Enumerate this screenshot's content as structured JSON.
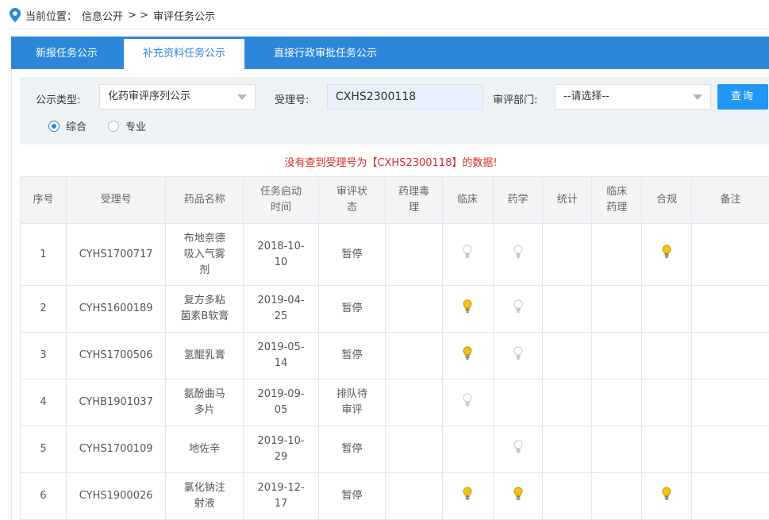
{
  "breadcrumb": {
    "prefix": "当前位置：",
    "path": "信息公开",
    "sep": "> >",
    "current": "审评任务公示"
  },
  "tabs": [
    {
      "label": "新报任务公示",
      "active": false
    },
    {
      "label": "补充资料任务公示",
      "active": true
    },
    {
      "label": "直接行政审批任务公示",
      "active": false
    }
  ],
  "filter": {
    "type_label": "公示类型:",
    "type_value": "化药审评序列公示",
    "accept_label": "受理号:",
    "accept_value": "CXHS2300118",
    "dept_label": "审评部门:",
    "dept_value": "--请选择--",
    "query_button": "查询",
    "radio_general": "综合",
    "radio_special": "专业",
    "selected_radio": "综合"
  },
  "message": "没有查到受理号为【CXHS2300118】的数据!",
  "colors": {
    "accent": "#2c87db",
    "bulb_on": "#f1c21b",
    "bulb_off": "#c9c9c9",
    "alert": "#d62a2a"
  },
  "table": {
    "headers": [
      "序号",
      "受理号",
      "药品名称",
      "任务启动时间",
      "审评状态",
      "药理毒理",
      "临床",
      "药学",
      "统计",
      "临床药理",
      "合规",
      "备注"
    ],
    "header_lines": [
      [
        "序号"
      ],
      [
        "受理号"
      ],
      [
        "药品名称"
      ],
      [
        "任务启动",
        "时间"
      ],
      [
        "审评状",
        "态"
      ],
      [
        "药理毒",
        "理"
      ],
      [
        "临床"
      ],
      [
        "药学"
      ],
      [
        "统计"
      ],
      [
        "临床",
        "药理"
      ],
      [
        "合规"
      ],
      [
        "备注"
      ]
    ],
    "rows": [
      {
        "no": "1",
        "accept": "CYHS1700717",
        "name_lines": [
          "布地奈德",
          "吸入气雾",
          "剂"
        ],
        "date_lines": [
          "2018-10-",
          "10"
        ],
        "status_lines": [
          "暂停"
        ],
        "tox": "",
        "clinical": "off",
        "pharm": "off",
        "stat": "",
        "clin_pharm": "",
        "compliance": "on",
        "note": ""
      },
      {
        "no": "2",
        "accept": "CYHS1600189",
        "name_lines": [
          "复方多粘",
          "菌素B软膏"
        ],
        "date_lines": [
          "2019-04-",
          "25"
        ],
        "status_lines": [
          "暂停"
        ],
        "tox": "",
        "clinical": "on",
        "pharm": "off",
        "stat": "",
        "clin_pharm": "",
        "compliance": "",
        "note": ""
      },
      {
        "no": "3",
        "accept": "CYHS1700506",
        "name_lines": [
          "氢醌乳膏"
        ],
        "date_lines": [
          "2019-05-",
          "14"
        ],
        "status_lines": [
          "暂停"
        ],
        "tox": "",
        "clinical": "on",
        "pharm": "off",
        "stat": "",
        "clin_pharm": "",
        "compliance": "",
        "note": ""
      },
      {
        "no": "4",
        "accept": "CYHB1901037",
        "name_lines": [
          "氨酚曲马",
          "多片"
        ],
        "date_lines": [
          "2019-09-",
          "05"
        ],
        "status_lines": [
          "排队待",
          "审评"
        ],
        "tox": "",
        "clinical": "off",
        "pharm": "",
        "stat": "",
        "clin_pharm": "",
        "compliance": "",
        "note": ""
      },
      {
        "no": "5",
        "accept": "CYHS1700109",
        "name_lines": [
          "地佐辛"
        ],
        "date_lines": [
          "2019-10-",
          "29"
        ],
        "status_lines": [
          "暂停"
        ],
        "tox": "",
        "clinical": "",
        "pharm": "off",
        "stat": "",
        "clin_pharm": "",
        "compliance": "",
        "note": ""
      },
      {
        "no": "6",
        "accept": "CYHS1900026",
        "name_lines": [
          "氯化钠注",
          "射液"
        ],
        "date_lines": [
          "2019-12-",
          "17"
        ],
        "status_lines": [
          "暂停"
        ],
        "tox": "",
        "clinical": "on",
        "pharm": "on",
        "stat": "",
        "clin_pharm": "",
        "compliance": "on",
        "note": ""
      }
    ]
  }
}
